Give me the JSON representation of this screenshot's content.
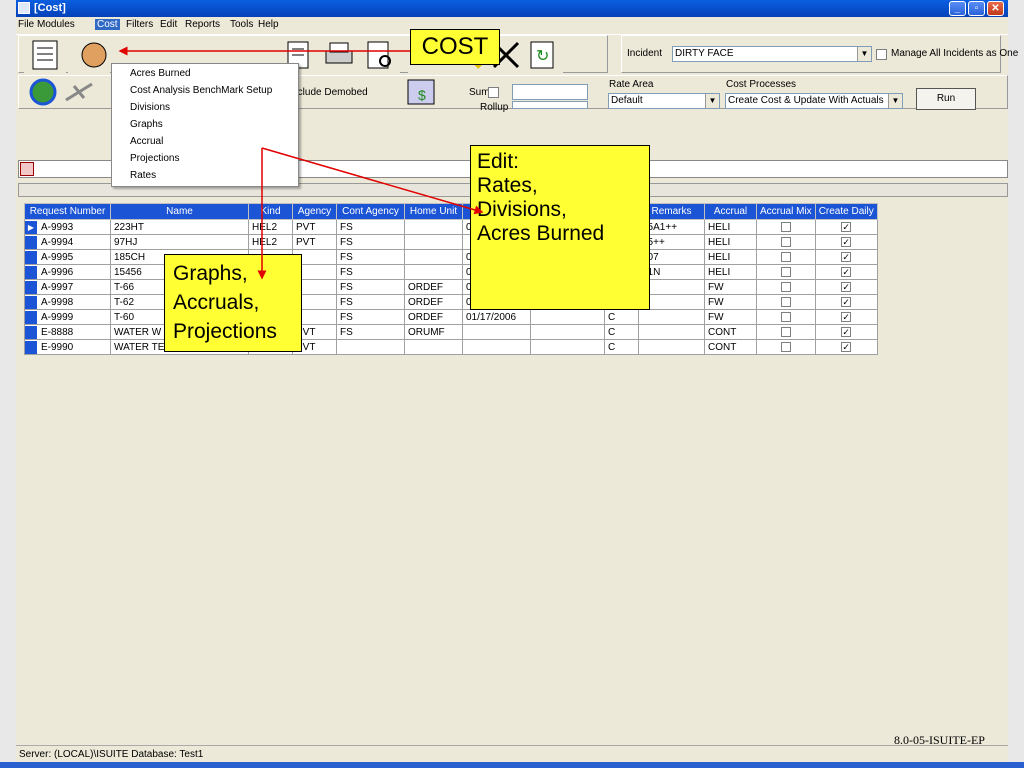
{
  "window": {
    "title": "[Cost]"
  },
  "menubar": {
    "items": [
      "File",
      "Modules",
      "Cost",
      "Filters",
      "Edit",
      "Reports",
      "Tools",
      "Help"
    ]
  },
  "cost_menu": {
    "items": [
      "Acres Burned",
      "Cost Analysis BenchMark Setup",
      "Divisions",
      "Graphs",
      "Accrual",
      "Projections",
      "Rates"
    ]
  },
  "incident": {
    "label": "Incident",
    "value": "DIRTY FACE",
    "manage_label": "Manage All Incidents as One"
  },
  "toolbar2": {
    "exclude_label": "Exclude Demobed",
    "sum_label": "Sum",
    "rollup_label": "Rollup",
    "rate_area_label": "Rate Area",
    "rate_area_value": "Default",
    "cost_processes_label": "Cost Processes",
    "cost_processes_value": "Create Cost & Update With Actuals",
    "run_label": "Run"
  },
  "table": {
    "headers": [
      "Request Number",
      "Name",
      "Kind",
      "Agency",
      "Cont Agency",
      "Home Unit",
      "",
      "",
      "",
      "Remarks",
      "Accrual",
      "Accrual Mix",
      "Create Daily"
    ],
    "rows": [
      {
        "req": "A-9993",
        "name": "223HT",
        "kind": "HEL2",
        "agency": "PVT",
        "cont": "FS",
        "home": "",
        "date": "0",
        "c": "",
        "remarks": "05A1++",
        "accrual": "HELI",
        "mix": false,
        "daily": true,
        "selected": true
      },
      {
        "req": "A-9994",
        "name": "97HJ",
        "kind": "HEL2",
        "agency": "PVT",
        "cont": "FS",
        "home": "",
        "date": "",
        "c": "",
        "remarks": "05++",
        "accrual": "HELI",
        "mix": false,
        "daily": true
      },
      {
        "req": "A-9995",
        "name": "185CH",
        "kind": "",
        "agency": "",
        "cont": "FS",
        "home": "",
        "date": "0",
        "c": "",
        "remarks": "107",
        "accrual": "HELI",
        "mix": false,
        "daily": true
      },
      {
        "req": "A-9996",
        "name": "15456",
        "kind": "",
        "agency": "",
        "cont": "FS",
        "home": "",
        "date": "0",
        "c": "",
        "remarks": "61N",
        "accrual": "HELI",
        "mix": false,
        "daily": true
      },
      {
        "req": "A-9997",
        "name": "T-66",
        "kind": "",
        "agency": "",
        "cont": "FS",
        "home": "ORDEF",
        "date": "0",
        "c": "",
        "remarks": "",
        "accrual": "FW",
        "mix": false,
        "daily": true
      },
      {
        "req": "A-9998",
        "name": "T-62",
        "kind": "",
        "agency": "",
        "cont": "FS",
        "home": "ORDEF",
        "date": "01/16/2006",
        "c": "C",
        "remarks": "",
        "accrual": "FW",
        "mix": false,
        "daily": true
      },
      {
        "req": "A-9999",
        "name": "T-60",
        "kind": "",
        "agency": "",
        "cont": "FS",
        "home": "ORDEF",
        "date": "01/17/2006",
        "c": "C",
        "remarks": "",
        "accrual": "FW",
        "mix": false,
        "daily": true
      },
      {
        "req": "E-8888",
        "name": "WATER W",
        "kind": "",
        "agency": "PVT",
        "cont": "FS",
        "home": "ORUMF",
        "date": "",
        "c": "C",
        "remarks": "",
        "accrual": "CONT",
        "mix": false,
        "daily": true
      },
      {
        "req": "E-9990",
        "name": "WATER TENDER",
        "kind": "WAT1",
        "agency": "PVT",
        "cont": "",
        "home": "",
        "date": "",
        "c": "C",
        "remarks": "",
        "accrual": "CONT",
        "mix": false,
        "daily": true
      }
    ]
  },
  "callouts": {
    "cost": "COST",
    "edit_lines": [
      "Edit:",
      "Rates,",
      "Divisions,",
      "Acres Burned"
    ],
    "graphs_lines": [
      "Graphs,",
      "Accruals,",
      "Projections"
    ]
  },
  "status": {
    "text": "Server: (LOCAL)\\ISUITE Database: Test1"
  },
  "footer_code": "8.0-05-ISUITE-EP",
  "colors": {
    "titlebar": "#0a5fe0",
    "grid_header": "#1c54d6",
    "callout": "#ffff33",
    "arrow": "#e00000"
  }
}
